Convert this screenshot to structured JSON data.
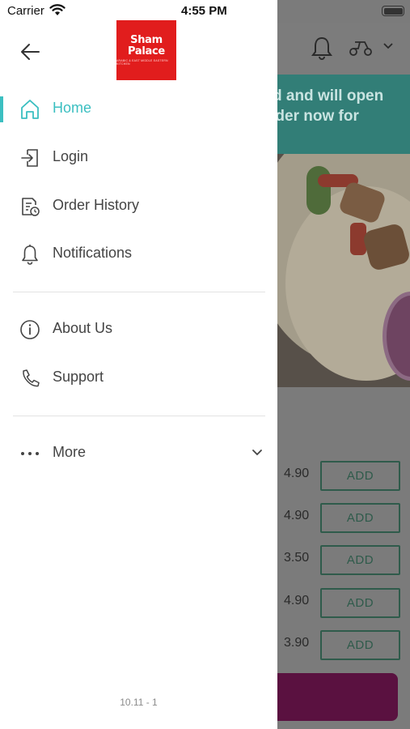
{
  "status_bar": {
    "carrier": "Carrier",
    "time": "4:55 PM"
  },
  "brand": {
    "logo_line1": "Sham",
    "logo_line2": "Palace",
    "logo_tagline": "ARABIC & EAST MIDDLE EASTERN KITCHEN",
    "logo_color": "#e11d1d"
  },
  "menu": {
    "items": [
      {
        "label": "Home",
        "icon": "home-icon",
        "active": true
      },
      {
        "label": "Login",
        "icon": "login-icon"
      },
      {
        "label": "Order History",
        "icon": "order-history-icon"
      },
      {
        "label": "Notifications",
        "icon": "bell-icon"
      },
      {
        "label": "About Us",
        "icon": "info-icon"
      },
      {
        "label": "Support",
        "icon": "phone-icon"
      },
      {
        "label": "More",
        "icon": "more-dots-icon"
      }
    ]
  },
  "version": "10.11 - 1",
  "accent_color": "#3bbfc1",
  "background": {
    "banner_line1": "d and will open",
    "banner_line2": "rder now for",
    "items": [
      {
        "price": "4.90",
        "action": "ADD"
      },
      {
        "price": "4.90",
        "action": "ADD"
      },
      {
        "price": "3.50",
        "action": "ADD"
      },
      {
        "price": "4.90",
        "action": "ADD"
      },
      {
        "price": "3.90",
        "action": "ADD"
      }
    ]
  }
}
